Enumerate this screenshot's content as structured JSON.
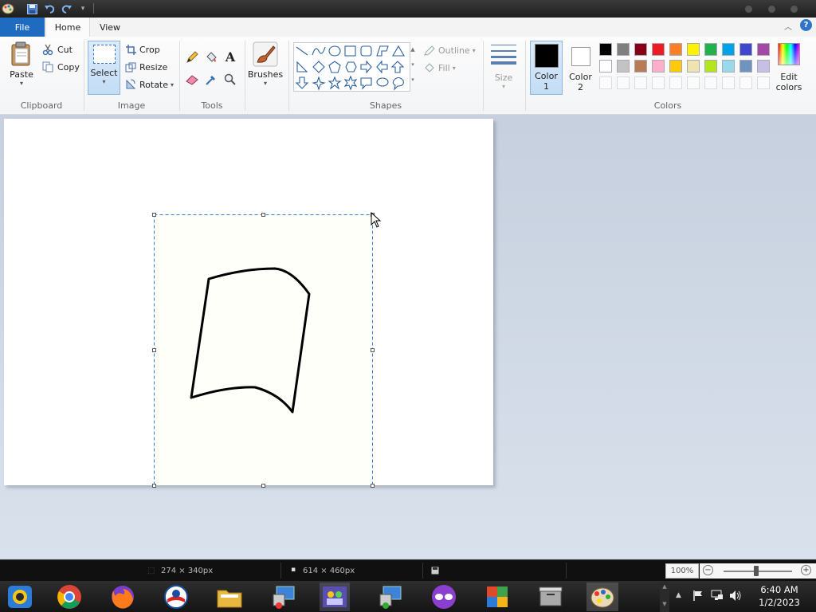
{
  "tabs": {
    "file": "File",
    "home": "Home",
    "view": "View"
  },
  "clipboard": {
    "paste": "Paste",
    "cut": "Cut",
    "copy": "Copy",
    "group": "Clipboard"
  },
  "image": {
    "select": "Select",
    "crop": "Crop",
    "resize": "Resize",
    "rotate": "Rotate",
    "group": "Image"
  },
  "tools": {
    "group": "Tools"
  },
  "brushes": {
    "label": "Brushes"
  },
  "shapes": {
    "outline": "Outline",
    "fill": "Fill",
    "group": "Shapes"
  },
  "size": {
    "label": "Size"
  },
  "colors": {
    "color1_line1": "Color",
    "color1_line2": "1",
    "color2_line1": "Color",
    "color2_line2": "2",
    "edit_line1": "Edit",
    "edit_line2": "colors",
    "group": "Colors",
    "color1_value": "#000000",
    "color2_value": "#ffffff",
    "row1": [
      "#000000",
      "#7f7f7f",
      "#880015",
      "#ed1c24",
      "#ff7f27",
      "#fff200",
      "#22b14c",
      "#00a2e8",
      "#3f48cc",
      "#a349a4"
    ],
    "row2": [
      "#ffffff",
      "#c3c3c3",
      "#b97a57",
      "#ffaec9",
      "#ffc90e",
      "#efe4b0",
      "#b5e61d",
      "#99d9ea",
      "#7092be",
      "#c8bfe7"
    ]
  },
  "status": {
    "selection_size": "274 × 340px",
    "canvas_size": "614 × 460px",
    "zoom": "100%"
  },
  "clock": {
    "time": "6:40 AM",
    "date": "1/2/2023"
  }
}
